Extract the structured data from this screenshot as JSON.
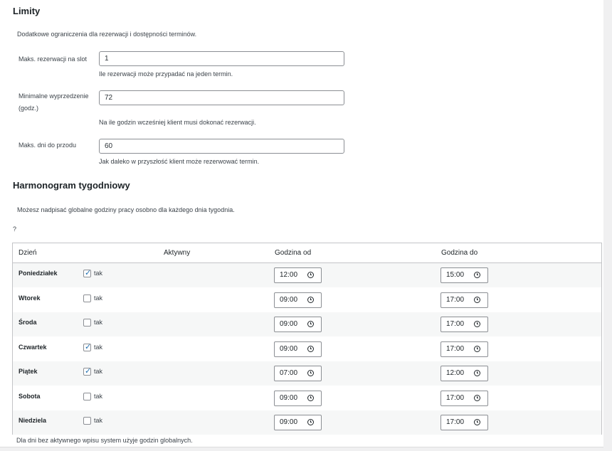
{
  "limits": {
    "title": "Limity",
    "description": "Dodatkowe ograniczenia dla rezerwacji i dostępności terminów.",
    "max_per_slot": {
      "label": "Maks. rezerwacji na slot",
      "value": "1",
      "hint": "Ile rezerwacji może przypadać na jeden termin."
    },
    "min_advance": {
      "label_line1": "Minimalne wyprzedzenie",
      "label_line2": "(godz.)",
      "value": "72",
      "hint": "Na ile godzin wcześniej klient musi dokonać rezerwacji."
    },
    "max_days_ahead": {
      "label": "Maks. dni do przodu",
      "value": "60",
      "hint": "Jak daleko w przyszłość klient może rezerwować termin."
    }
  },
  "schedule": {
    "title": "Harmonogram tygodniowy",
    "description": "Możesz nadpisać globalne godziny pracy osobno dla każdego dnia tygodnia.",
    "question_mark": "?",
    "columns": {
      "day": "Dzień",
      "active": "Aktywny",
      "from": "Godzina od",
      "to": "Godzina do"
    },
    "rows": [
      {
        "day": "Poniedziałek",
        "active": true,
        "active_label": "tak",
        "from": "12:00",
        "to": "15:00"
      },
      {
        "day": "Wtorek",
        "active": false,
        "active_label": "tak",
        "from": "09:00",
        "to": "17:00"
      },
      {
        "day": "Środa",
        "active": false,
        "active_label": "tak",
        "from": "09:00",
        "to": "17:00"
      },
      {
        "day": "Czwartek",
        "active": true,
        "active_label": "tak",
        "from": "09:00",
        "to": "17:00"
      },
      {
        "day": "Piątek",
        "active": true,
        "active_label": "tak",
        "from": "07:00",
        "to": "12:00"
      },
      {
        "day": "Sobota",
        "active": false,
        "active_label": "tak",
        "from": "09:00",
        "to": "17:00"
      },
      {
        "day": "Niedziela",
        "active": false,
        "active_label": "tak",
        "from": "09:00",
        "to": "17:00"
      }
    ],
    "footer": "Dla dni bez aktywnego wpisu system użyje godzin globalnych."
  },
  "colors": {
    "accent": "#2271b1",
    "row_alt": "#f6f7f7",
    "border": "#c3c4c7"
  },
  "icons": {
    "time_input": "clock-icon",
    "checkbox": "checkmark-icon"
  }
}
